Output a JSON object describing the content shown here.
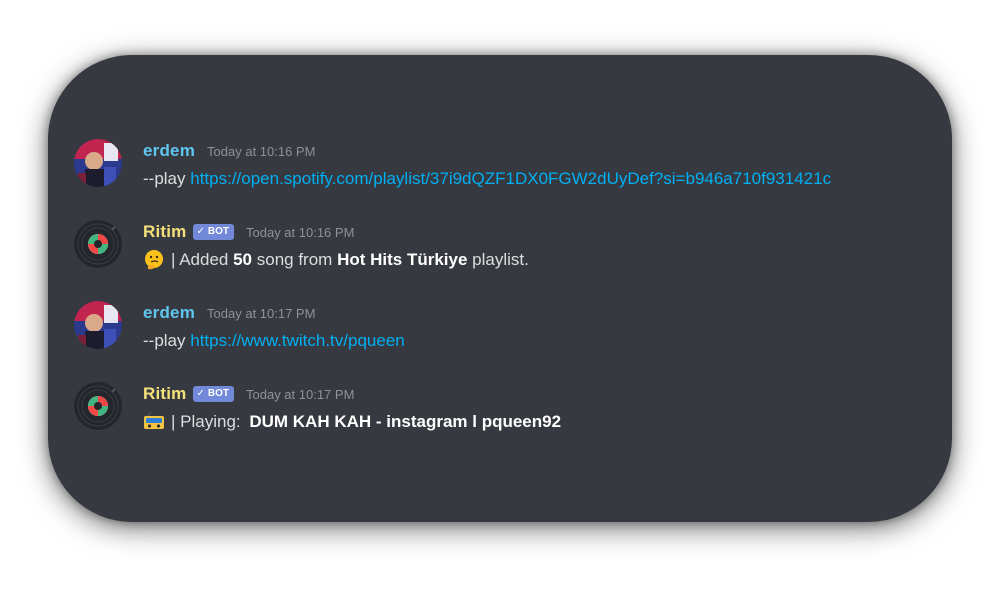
{
  "messages": [
    {
      "author": "erdem",
      "timestamp": "Today at 10:16 PM",
      "command": "--play ",
      "link": "https://open.spotify.com/playlist/37i9dQZF1DX0FGW2dUyDef?si=b946a710f931421c"
    },
    {
      "author": "Ritim",
      "bot_tag": "BOT",
      "timestamp": "Today at 10:16 PM",
      "emoji": "thinking-face-icon",
      "text_1": "| Added ",
      "count": "50",
      "text_2": " song from ",
      "playlist": "Hot Hits Türkiye",
      "text_3": " playlist."
    },
    {
      "author": "erdem",
      "timestamp": "Today at 10:17 PM",
      "command": "--play ",
      "link": "https://www.twitch.tv/pqueen"
    },
    {
      "author": "Ritim",
      "bot_tag": "BOT",
      "timestamp": "Today at 10:17 PM",
      "emoji": "radio-icon",
      "text_1": "| Playing: ",
      "track": "DUM KAH KAH - instagram l pqueen92"
    }
  ],
  "colors": {
    "background": "#36393f",
    "user_name": "#5fc6f0",
    "bot_name": "#f5e17a",
    "bot_tag": "#7289da",
    "link": "#00b0f4",
    "timestamp": "#8e9297",
    "text": "#dcddde"
  }
}
